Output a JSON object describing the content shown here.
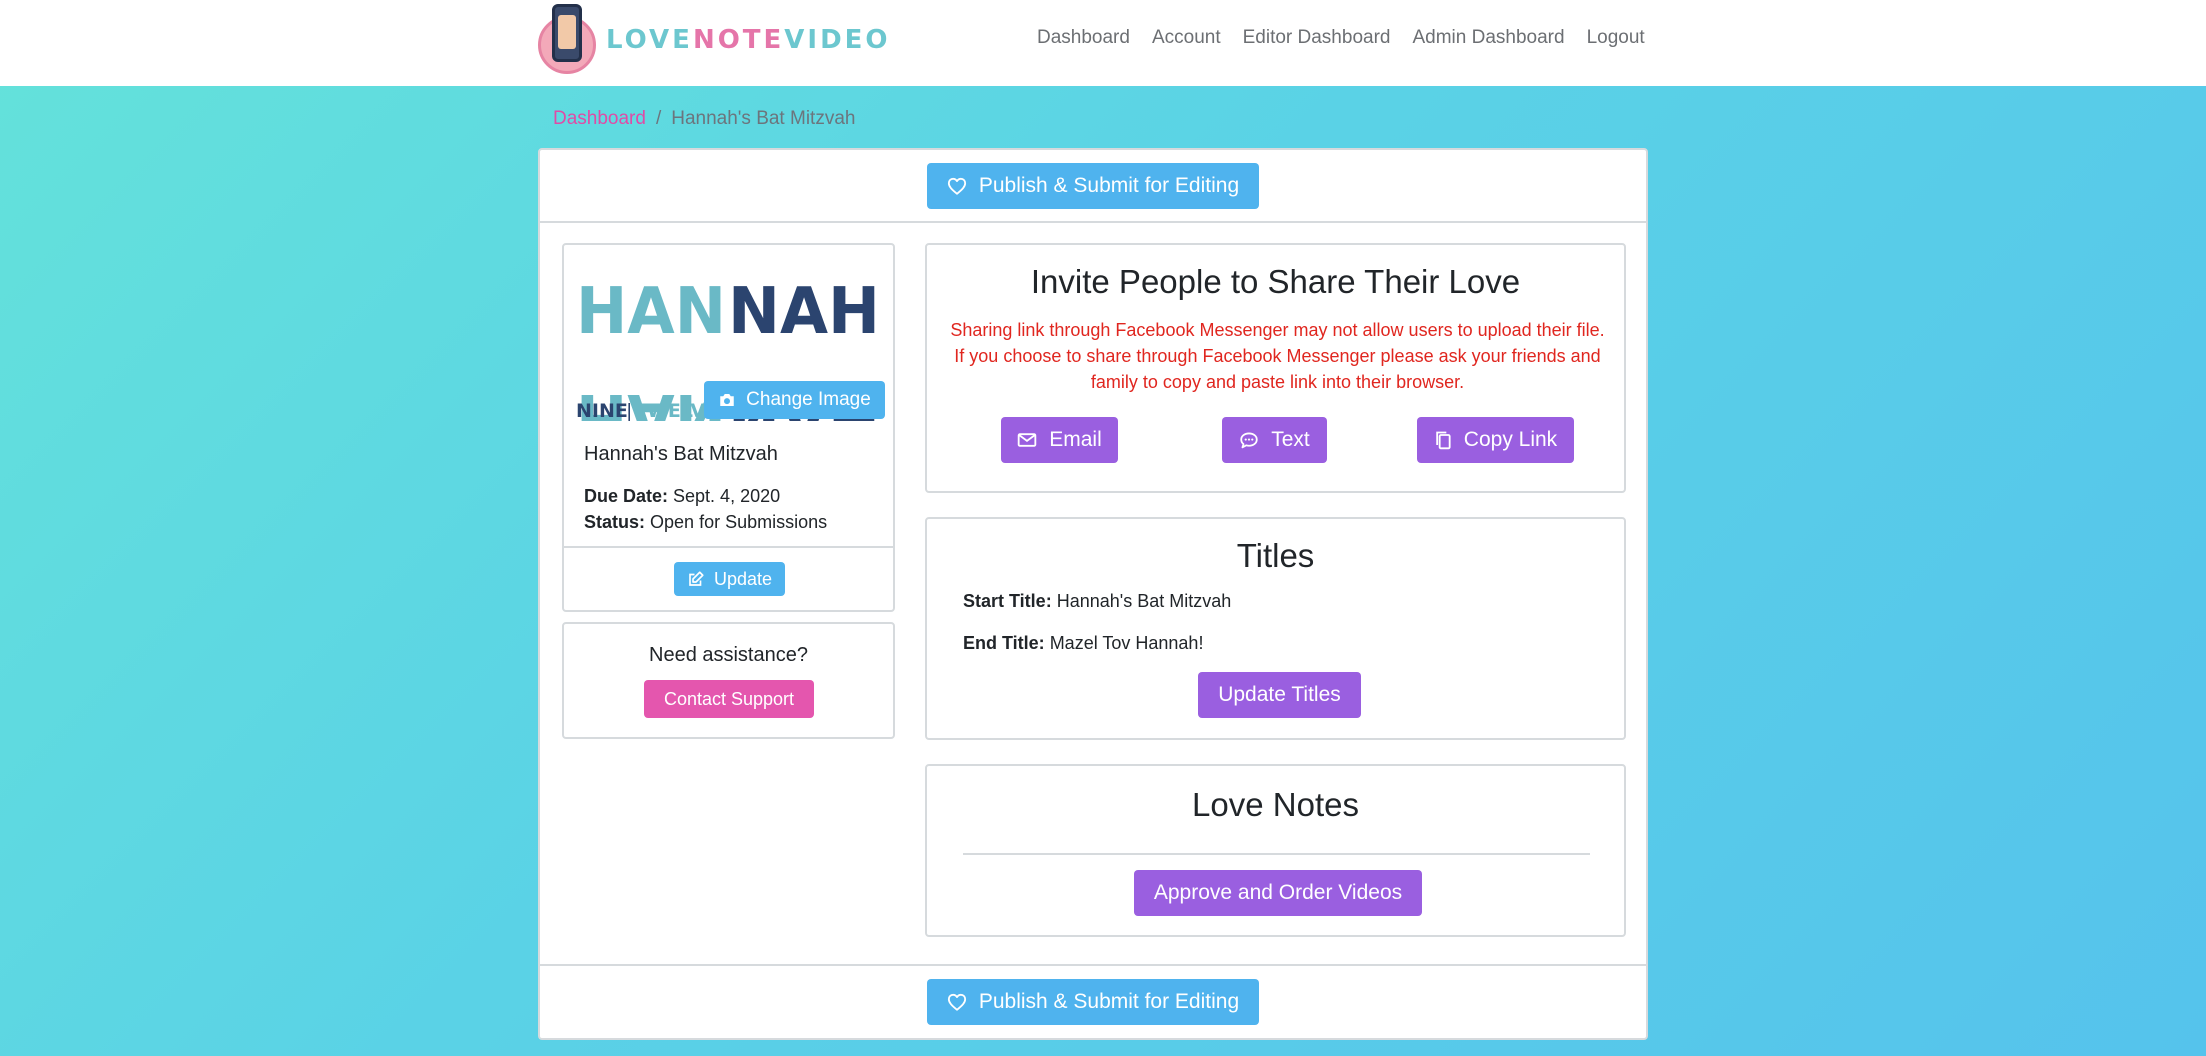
{
  "brand": {
    "logo_text_part1": "LOVE",
    "logo_text_part2": "NOTE",
    "logo_text_part3": "VIDEO",
    "colors": {
      "teal": "#6cc7cf",
      "pink": "#e575a9"
    }
  },
  "nav": {
    "items": [
      {
        "label": "Dashboard"
      },
      {
        "label": "Account"
      },
      {
        "label": "Editor Dashboard"
      },
      {
        "label": "Admin Dashboard"
      },
      {
        "label": "Logout"
      }
    ]
  },
  "breadcrumb": {
    "link": "Dashboard",
    "separator": "/",
    "current": "Hannah's Bat Mitzvah"
  },
  "publish": {
    "label": "Publish & Submit for Editing",
    "icon": "heart-icon"
  },
  "event": {
    "image_alt": "HANNAH NINE|TWELVE",
    "image_text_top_left": "HAN",
    "image_text_top_right": "NAH",
    "image_text_sub_left": "NINE",
    "image_text_sub_right": "TWELVE",
    "change_image_label": "Change Image",
    "title": "Hannah's Bat Mitzvah",
    "due_date_label": "Due Date:",
    "due_date_value": "Sept. 4, 2020",
    "status_label": "Status:",
    "status_value": "Open for Submissions",
    "update_label": "Update"
  },
  "assist": {
    "title": "Need assistance?",
    "contact_label": "Contact Support"
  },
  "invite": {
    "title": "Invite People to Share Their Love",
    "warning": "Sharing link through Facebook Messenger may not allow users to upload their file. If you choose to share through Facebook Messenger please ask your friends and family to copy and paste link into their browser.",
    "email_label": "Email",
    "text_label": "Text",
    "copy_label": "Copy Link"
  },
  "titles": {
    "heading": "Titles",
    "start_label": "Start Title:",
    "start_value": "Hannah's Bat Mitzvah",
    "end_label": "End Title:",
    "end_value": "Mazel Tov Hannah!",
    "update_label": "Update Titles"
  },
  "love_notes": {
    "heading": "Love Notes",
    "approve_label": "Approve and Order Videos"
  },
  "colors": {
    "primary_blue": "#4fb3ee",
    "purple": "#9a5fe0",
    "pink": "#e456ae",
    "warning_red": "#e0261f",
    "link_pink": "#e04ba6"
  }
}
